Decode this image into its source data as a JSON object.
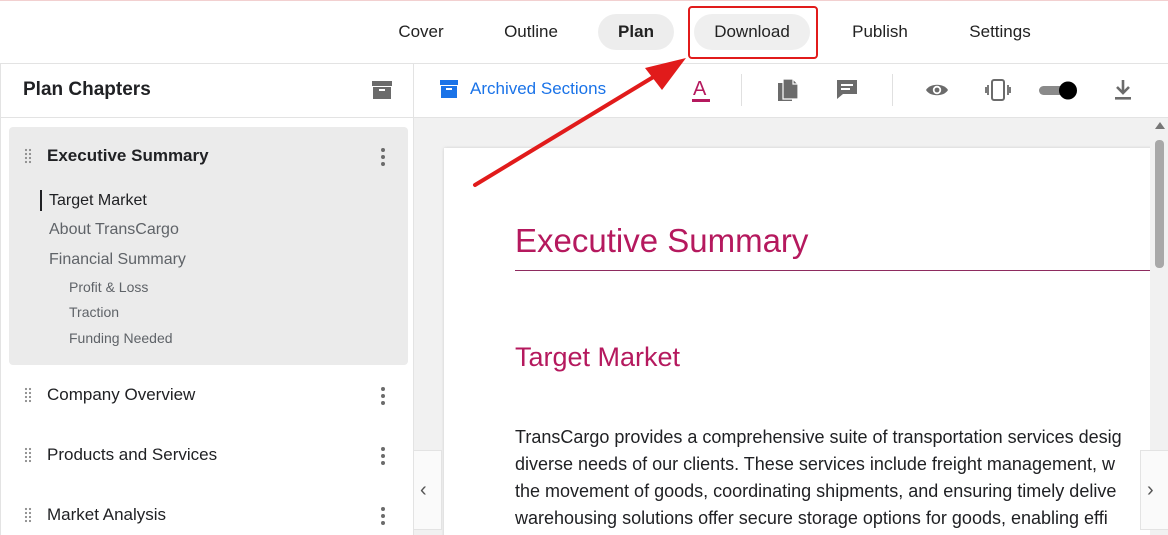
{
  "nav": {
    "tabs": [
      {
        "label": "Cover"
      },
      {
        "label": "Outline"
      },
      {
        "label": "Plan"
      },
      {
        "label": "Download"
      },
      {
        "label": "Publish"
      },
      {
        "label": "Settings"
      }
    ],
    "active": "Plan",
    "highlighted": "Download"
  },
  "sidebar": {
    "title": "Plan Chapters",
    "archive_icon": "archive-icon",
    "chapters": [
      {
        "title": "Executive Summary"
      },
      {
        "title": "Company Overview"
      },
      {
        "title": "Products and Services"
      },
      {
        "title": "Market Analysis"
      }
    ],
    "sections": [
      {
        "label": "Target Market"
      },
      {
        "label": "About TransCargo"
      },
      {
        "label": "Financial Summary"
      }
    ],
    "subsections": [
      {
        "label": "Profit & Loss"
      },
      {
        "label": "Traction"
      },
      {
        "label": "Funding Needed"
      }
    ]
  },
  "toolbar": {
    "archived_label": "Archived Sections",
    "icons": [
      "text-color-icon",
      "document-icon",
      "comment-icon",
      "preview-eye-icon",
      "mobile-vibrate-icon",
      "toggle-switch",
      "download-icon"
    ]
  },
  "document": {
    "heading": "Executive Summary",
    "subheading": "Target Market",
    "lines": [
      "TransCargo provides a comprehensive suite of transportation services desig",
      "diverse needs of our clients. These services include freight management, w",
      "the movement of goods, coordinating shipments, and ensuring timely delive",
      "warehousing solutions offer secure storage options for goods, enabling effi"
    ]
  },
  "colors": {
    "accent_link": "#1a73e8",
    "heading": "#b5195e",
    "annotation": "#e11b1b"
  }
}
